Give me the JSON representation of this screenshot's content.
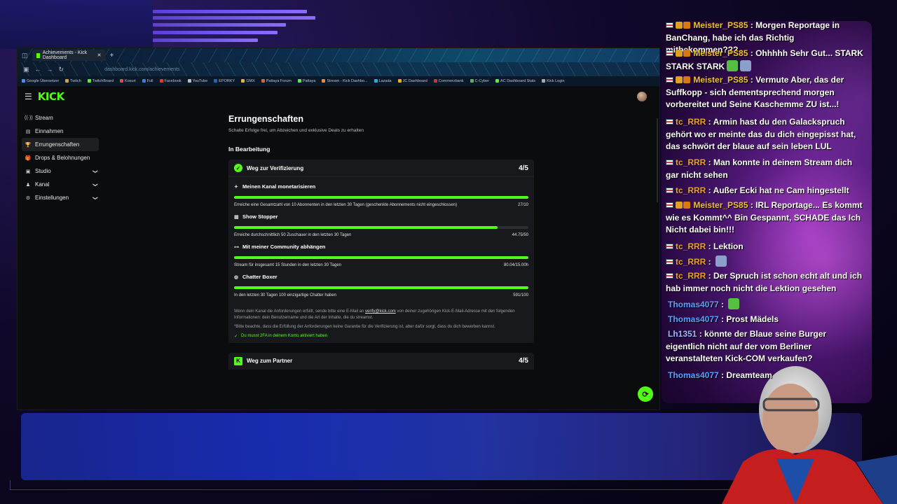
{
  "browser": {
    "tab_title": "Achievements - Kick Dashboard",
    "tab_new": "+",
    "url": "dashboard.kick.com/achievements",
    "bookmarks": [
      "Google Übersetzer",
      "Twitch",
      "TwitchBoard",
      "Kosuri",
      "Full",
      "Facebook",
      "YouTube",
      "EPORKY",
      "GMX",
      "Pattaya Forum",
      "Pattaya",
      "Stream - Kick Dashbo...",
      "Lazada",
      "JC Dashboard",
      "Commerzbank",
      "C-Cyber",
      "AC Dashboard Stats",
      "Kick Login"
    ]
  },
  "kick": {
    "logo": "KICK",
    "sidebar": [
      {
        "label": "Stream",
        "icon": "((·))",
        "chevron": false
      },
      {
        "label": "Einnahmen",
        "icon": "▤",
        "chevron": false
      },
      {
        "label": "Errungenschaften",
        "icon": "🏆",
        "chevron": false,
        "active": true
      },
      {
        "label": "Drops & Belohnungen",
        "icon": "🎁",
        "chevron": false
      },
      {
        "label": "Studio",
        "icon": "▣",
        "chevron": true
      },
      {
        "label": "Kanal",
        "icon": "♟",
        "chevron": true
      },
      {
        "label": "Einstellungen",
        "icon": "⚙",
        "chevron": true
      }
    ],
    "page_title": "Errungenschaften",
    "page_subtitle": "Schalte Erfolge frei, um Abzeichen und exklusive Deals zu erhalten",
    "section_title": "In Bearbeitung",
    "card1": {
      "title": "Weg zur Verifizierung",
      "count": "4/5",
      "tasks": [
        {
          "title": "Meinen Kanal monetarisieren",
          "icon": "✦",
          "desc": "Erreiche eine Gesamtzahl von 10 Abonnenten in den letzten 30 Tagen (geschenkte Abonnements nicht eingeschlossen)",
          "value": "27/10",
          "progress": 1.0
        },
        {
          "title": "Show Stopper",
          "icon": "▦",
          "desc": "Erreiche durchschnittlich 50 Zuschauer in den letzten 30 Tagen",
          "value": "44.75/50",
          "progress": 0.895
        },
        {
          "title": "Mit meiner Community abhängen",
          "icon": "⊶",
          "desc": "Stream für insgesamt 15 Stunden in den letzten 30 Tagen",
          "value": "80.04/15.00h",
          "progress": 1.0
        },
        {
          "title": "Chatter Boxer",
          "icon": "◍",
          "desc": "In den letzten 30 Tagen 100 einzigartige Chatter haben",
          "value": "591/100",
          "progress": 1.0
        }
      ],
      "note_pre": "Wenn dein Kanal die Anforderungen erfüllt, sende bitte eine E-Mail an",
      "note_link": "verify@kick.com",
      "note_post": "von deiner zugehörigen Kick-E-Mail-Adresse mit den folgenden Informationen: dein Benutzername und die Art der Inhalte, die du streamst.",
      "note2": "*Bitte beachte, dass die Erfüllung der Anforderungen keine Garantie für die Verifizierung ist, aber dafür sorgt, dass du dich bewerben kannst.",
      "check": "Du musst 2FA in deinem Konto aktiviert haben"
    },
    "card2": {
      "title": "Weg zum Partner",
      "count": "4/5"
    }
  },
  "chat": [
    {
      "name": "Meister_PS85",
      "color": "#f0c030",
      "badges": true,
      "text": "Morgen Reportage in BanChang, habe ich das Richtig mitbekommen???"
    },
    {
      "name": "Meister_PS85",
      "color": "#f0c030",
      "badges": true,
      "text": "Ohhhhh Sehr Gut... STARK STARK STARK",
      "emotes": 2
    },
    {
      "name": "Meister_PS85",
      "color": "#f0c030",
      "badges": true,
      "text": "Vermute Aber, das der Suffkopp - sich dementsprechend morgen vorbereitet und Seine Kaschemme ZU ist...!"
    },
    {
      "name": "tc_RRR",
      "color": "#f0a020",
      "badges": false,
      "text": "Armin hast du den Galackspruch gehört wo er meinte das du dich eingepisst hat, das schwört der blaue auf sein leben LUL"
    },
    {
      "name": "tc_RRR",
      "color": "#f0a020",
      "badges": false,
      "text": "Man konnte in deinem Stream dich gar nicht sehen"
    },
    {
      "name": "tc_RRR",
      "color": "#f0a020",
      "badges": false,
      "text": "Außer Ecki hat ne Cam hingestellt"
    },
    {
      "name": "Meister_PS85",
      "color": "#f0c030",
      "badges": true,
      "text": "IRL Reportage... Es kommt wie es Kommt^^ Bin Gespannt, SCHADE das Ich Nicht dabei bin!!!"
    },
    {
      "name": "tc_RRR",
      "color": "#f0a020",
      "badges": false,
      "text": "Lektion"
    },
    {
      "name": "tc_RRR",
      "color": "#f0a020",
      "badges": false,
      "text": "",
      "emotes": 1
    },
    {
      "name": "tc_RRR",
      "color": "#f0a020",
      "badges": false,
      "text": "Der Spruch ist schon echt alt und ich hab immer noch nicht die Lektion gesehen"
    },
    {
      "name": "Thomas4077",
      "color": "#5aa0ff",
      "badges": false,
      "noflag": true,
      "text": "",
      "emotes": 1
    },
    {
      "name": "Thomas4077",
      "color": "#5aa0ff",
      "badges": false,
      "noflag": true,
      "text": "Prost Mädels"
    },
    {
      "name": "Lh1351",
      "color": "#9ab8ff",
      "badges": false,
      "noflag": true,
      "text": "könnte der Blaue seine Burger eigentlich nicht auf der vom Berliner veranstalteten Kick-COM verkaufen?"
    },
    {
      "name": "Thomas4077",
      "color": "#5aa0ff",
      "badges": false,
      "noflag": true,
      "text": "Dreamteam"
    }
  ],
  "colors": {
    "kick_green": "#53fc18"
  }
}
